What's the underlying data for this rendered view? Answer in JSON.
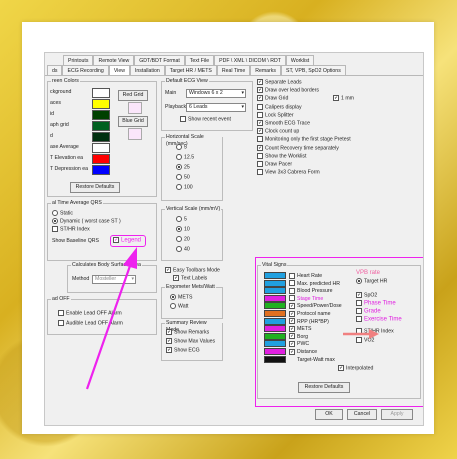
{
  "tabs_row1": [
    "Printouts",
    "Remote View",
    "GDT/BDT Format",
    "Text File",
    "PDF \\ XML \\ DICOM \\ RDT",
    "Worklist"
  ],
  "tabs_row2": [
    "ds",
    "ECG Recording",
    "View",
    "Installation",
    "Target HR / METS",
    "Real Time",
    "Remarks",
    "ST, VPB, SpO2 Options"
  ],
  "screen_colors": {
    "title": "reen Colors",
    "items": [
      {
        "label": "ckground",
        "color": "#ffffff"
      },
      {
        "label": "aces",
        "color": "#ffff00"
      },
      {
        "label": "id",
        "color": "#004000"
      },
      {
        "label": "aph grid",
        "color": "#006020"
      },
      {
        "label": "d",
        "color": "#003010"
      },
      {
        "label": "ase Average",
        "color": "#ffffff"
      },
      {
        "label": "T Elevation ea",
        "color": "#ff0000"
      },
      {
        "label": "T Depression ea",
        "color": "#0000ff"
      }
    ],
    "red_grid": "Red Grid",
    "blue_grid": "Blue Grid",
    "restore": "Restore Defaults"
  },
  "rt_avg": {
    "title": "al Time Average QRS",
    "static": "Static",
    "dynamic": "Dynamic ( worst case ST )",
    "st_hr": "ST/HR Index",
    "show_baseline": "Show Baseline QRS",
    "legend": "Legend"
  },
  "body_surface": {
    "title": "Calculates Body Surface Area",
    "method_label": "Method",
    "method_value": "Mosteller"
  },
  "lead_off": {
    "title": "ad OFF",
    "enable": "Enable Lead OFF Alarm",
    "audible": "Audible Lead OFF Alarm"
  },
  "default_view": {
    "title": "Default ECG View",
    "main_label": "Main",
    "main_value": "Windows 6 x 2",
    "playback_label": "Playback",
    "playback_value": "6 Leads",
    "show_recent": "Show recent event"
  },
  "hscale": {
    "title": "Horizontal Scale (mm/sec)",
    "options": [
      "5",
      "12.5",
      "25",
      "50",
      "100"
    ],
    "selected": 2
  },
  "vscale": {
    "title": "Vertical Scale (mm/mV)",
    "options": [
      "5",
      "10",
      "20",
      "40"
    ],
    "selected": 1
  },
  "toolbars": {
    "easy": "Easy Toolbars Mode",
    "text": "Text Labels"
  },
  "ergometer": {
    "title": "Ergometer Mets/Watt",
    "mets": "METS",
    "watt": "Watt"
  },
  "summary_review": {
    "title": "Summary Review Mode",
    "items": [
      "Show Remarks",
      "Show Max Values",
      "Show ECG"
    ]
  },
  "right_checks": [
    "Separate Leads",
    "Draw over lead borders",
    "Draw Grid",
    "Calipers display",
    "Lock Splitter",
    "Smooth ECG Trace",
    "Clock count up",
    "Monitoring only the first stage Pretest",
    "Count Recovery time separately",
    "Show the Worklist",
    "Draw Pacer",
    "View 3x3 Cabrera Form"
  ],
  "draw_grid_mm": "1 mm",
  "vital_signs": {
    "title": "Vital Signs",
    "left": [
      {
        "label": "Heart Rate",
        "color": "#20a0e0",
        "textcolor": "#222222"
      },
      {
        "label": "Max. predicted HR",
        "color": "#20a0e0",
        "textcolor": "#222222"
      },
      {
        "label": "Blood Pressure",
        "color": "#20a0e0",
        "textcolor": "#222222"
      },
      {
        "label": "Stage Time",
        "color": "#e020e0",
        "textcolor": "#e020e0"
      },
      {
        "label": "Speed/Power/Dose",
        "color": "#20b020",
        "textcolor": "#222222"
      },
      {
        "label": "Protocol name",
        "color": "#e07020",
        "textcolor": "#222222"
      },
      {
        "label": "RPP (HR*BP)",
        "color": "#20a0e0",
        "textcolor": "#222222"
      },
      {
        "label": "METS",
        "color": "#e020e0",
        "textcolor": "#222222"
      },
      {
        "label": "Borg",
        "color": "#20b020",
        "textcolor": "#222222"
      },
      {
        "label": "PWC",
        "color": "#20a0e0",
        "textcolor": "#222222"
      },
      {
        "label": "Distance",
        "color": "#e020e0",
        "textcolor": "#222222"
      },
      {
        "label": "Target-Watt max",
        "color": "#111111",
        "textcolor": "#222222"
      }
    ],
    "right": [
      {
        "label": "VPB rate",
        "textcolor": "#f060a0"
      },
      {
        "label": "Target HR",
        "textcolor": "#222222"
      },
      {
        "label": "SpO2",
        "textcolor": "#222222"
      },
      {
        "label": "Phase Time",
        "textcolor": "#e020e0"
      },
      {
        "label": "Grade",
        "textcolor": "#e020e0"
      },
      {
        "label": "Exercise Time",
        "textcolor": "#e020e0"
      },
      {
        "label": "ST/HR Index",
        "textcolor": "#222222"
      },
      {
        "label": "VO2",
        "textcolor": "#222222"
      }
    ],
    "interpolated": "Interpolated",
    "restore": "Restore Defaults"
  },
  "footer": {
    "ok": "OK",
    "cancel": "Cancel",
    "apply": "Apply"
  },
  "colors": {
    "highlight": "#ee22ee",
    "arrow": "#ee22ee"
  }
}
